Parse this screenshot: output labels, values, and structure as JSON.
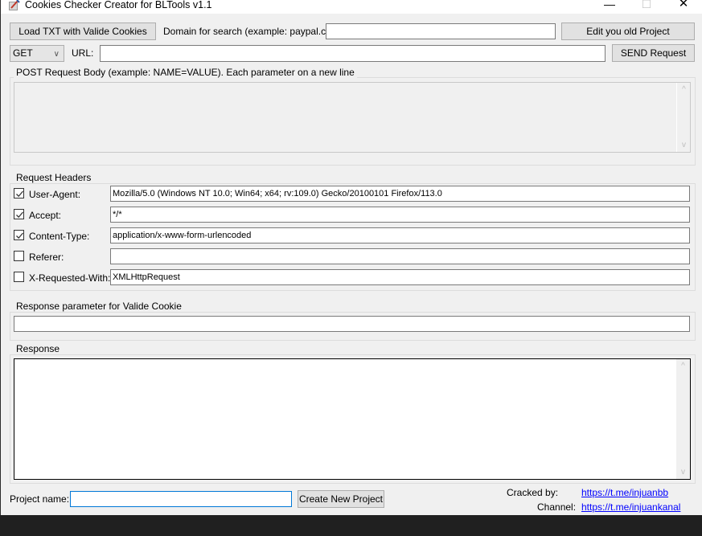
{
  "window": {
    "title": "Cookies Checker Creator for BLTools v1.1",
    "controls": {
      "minimize": "—",
      "maximize": "☐",
      "close": "✕"
    }
  },
  "toolbar": {
    "load_button": "Load TXT with Valide Cookies",
    "domain_label": "Domain for search (example: paypal.com):",
    "domain_value": "",
    "edit_button": "Edit you old Project",
    "method_selected": "GET",
    "url_label": "URL:",
    "url_value": "",
    "send_button": "SEND Request"
  },
  "post_body": {
    "title": "POST Request Body (example: NAME=VALUE). Each parameter on a new line",
    "value": ""
  },
  "headers": {
    "title": "Request Headers",
    "items": [
      {
        "label": "User-Agent:",
        "checked": true,
        "value": "Mozilla/5.0 (Windows NT 10.0; Win64; x64; rv:109.0) Gecko/20100101 Firefox/113.0"
      },
      {
        "label": "Accept:",
        "checked": true,
        "value": "*/*"
      },
      {
        "label": "Content-Type:",
        "checked": true,
        "value": "application/x-www-form-urlencoded"
      },
      {
        "label": "Referer:",
        "checked": false,
        "value": ""
      },
      {
        "label": "X-Requested-With:",
        "checked": false,
        "value": "XMLHttpRequest"
      }
    ]
  },
  "response_param": {
    "title": "Response parameter for Valide Cookie",
    "value": ""
  },
  "response": {
    "title": "Response",
    "value": ""
  },
  "footer": {
    "project_name_label": "Project name:",
    "project_name_value": "",
    "create_button": "Create New Project",
    "cracked_by_label": "Cracked by:",
    "cracked_by_link": "https://t.me/injuanbb",
    "channel_label": "Channel:",
    "channel_link": "https://t.me/injuankanal"
  },
  "icons": {
    "scroll_up": "^",
    "scroll_down": "v",
    "dropdown": "∨"
  }
}
